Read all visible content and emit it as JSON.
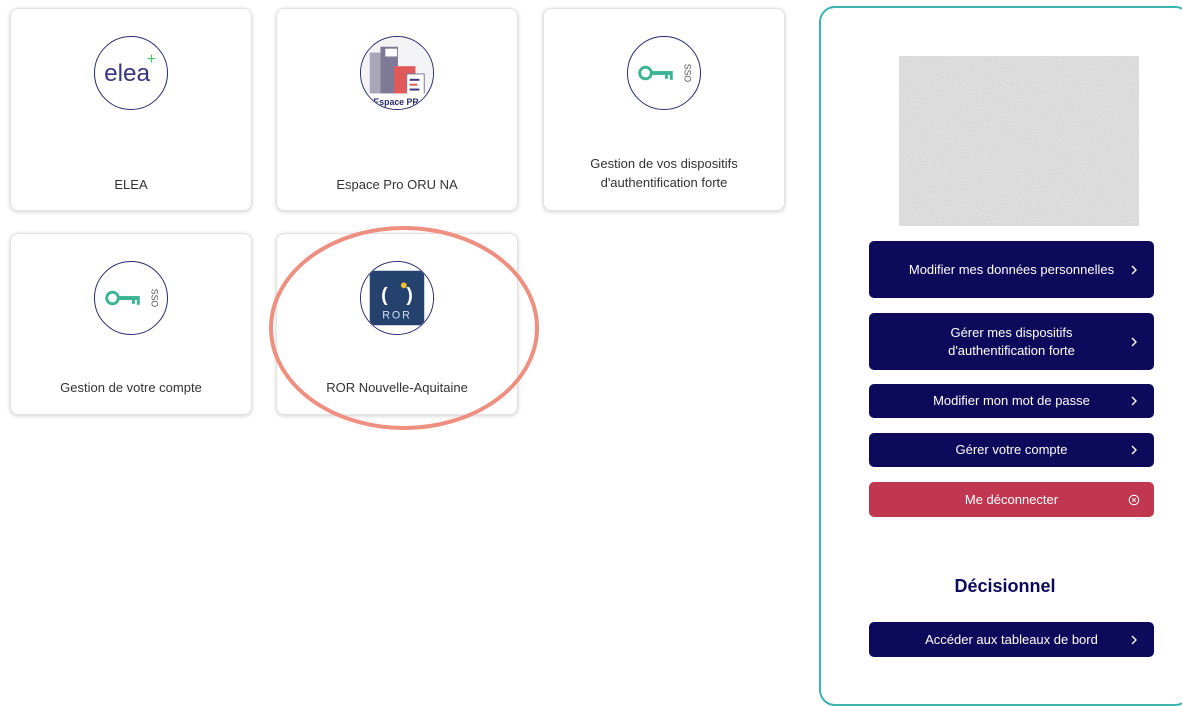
{
  "tiles": [
    {
      "label": "ELEA",
      "logo": "elea-logo"
    },
    {
      "label": "Espace Pro ORU NA",
      "logo": "espace-pro-logo",
      "logo_text": "Espace PR"
    },
    {
      "label": "Gestion de vos dispositifs d'authentification forte",
      "logo": "sso-key-icon",
      "logo_text": "SSO"
    },
    {
      "label": "Gestion de votre compte",
      "logo": "sso-key-icon",
      "logo_text": "SSO"
    },
    {
      "label": "ROR Nouvelle-Aquitaine",
      "logo": "ror-logo",
      "logo_text": "ROR"
    }
  ],
  "logos": {
    "elea_text": "elea",
    "elea_plus": "+"
  },
  "profile": {
    "buttons": [
      {
        "label": "Modifier mes données personnelles",
        "icon": "chevron-right-icon"
      },
      {
        "label": "Gérer mes dispositifs d'authentification forte",
        "icon": "chevron-right-icon"
      },
      {
        "label": "Modifier mon mot de passe",
        "icon": "chevron-right-icon"
      },
      {
        "label": "Gérer votre compte",
        "icon": "chevron-right-icon"
      }
    ],
    "logout": {
      "label": "Me déconnecter",
      "icon": "close-circle-icon"
    },
    "decisionnel": {
      "title": "Décisionnel",
      "button": {
        "label": "Accéder aux tableaux de bord",
        "icon": "chevron-right-icon"
      }
    }
  },
  "colors": {
    "primary": "#0d0a5b",
    "logout": "#c0374f",
    "panel_border": "#3bb4ae",
    "highlight_ellipse": "#ef8f80"
  }
}
